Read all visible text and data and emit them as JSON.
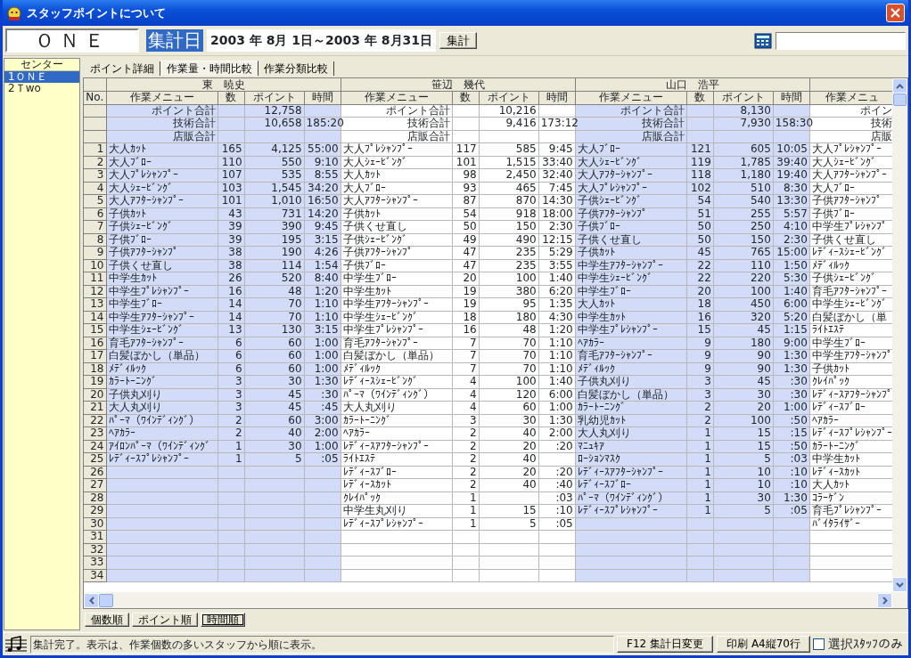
{
  "window": {
    "title": "スタッフポイントについて"
  },
  "toolbar": {
    "center_name": "ＯＮＥ",
    "date_label": "集計日",
    "date_range": "2003 年 8月 1日～2003 年 8月31日",
    "aggregate_button": "集計"
  },
  "sidebar": {
    "header": "センター",
    "items": [
      {
        "label": "1ＯＮＥ",
        "selected": true
      },
      {
        "label": "2Ｔwo",
        "selected": false
      }
    ]
  },
  "tabs": [
    {
      "label": "ポイント詳細",
      "selected": false
    },
    {
      "label": "作業量・時間比較",
      "selected": true
    },
    {
      "label": "作業分類比較",
      "selected": false
    }
  ],
  "grid": {
    "no_header": "No.",
    "row_numbers": [
      "1",
      "2",
      "3",
      "4",
      "5",
      "6",
      "7",
      "8",
      "9",
      "10",
      "11",
      "12",
      "13",
      "14",
      "15",
      "16",
      "17",
      "18",
      "19",
      "20",
      "21",
      "22",
      "23",
      "24",
      "25",
      "26",
      "27",
      "28",
      "29",
      "30",
      "31",
      "32",
      "33",
      "34"
    ],
    "staff": [
      {
        "name": "東　暁史",
        "shaded": true,
        "columns": [
          "作業メニュー",
          "数",
          "ポイント",
          "時間"
        ],
        "totals": [
          {
            "label": "ポイント合計",
            "points": "12,758"
          },
          {
            "label": "技術合計",
            "points": "10,658",
            "time": "185:20"
          },
          {
            "label": "店販合計"
          }
        ],
        "rows": [
          {
            "menu": "大人ｶｯﾄ",
            "count": "165",
            "points": "4,125",
            "time": "55:00"
          },
          {
            "menu": "大人ﾌﾞﾛｰ",
            "count": "110",
            "points": "550",
            "time": "9:10"
          },
          {
            "menu": "大人ﾌﾟﾚｼｬﾝﾌﾟｰ",
            "count": "107",
            "points": "535",
            "time": "8:55"
          },
          {
            "menu": "大人ｼｪｰﾋﾞﾝｸﾞ",
            "count": "103",
            "points": "1,545",
            "time": "34:20"
          },
          {
            "menu": "大人ｱﾌﾀｰｼｬﾝﾌﾟｰ",
            "count": "101",
            "points": "1,010",
            "time": "16:50"
          },
          {
            "menu": "子供ｶｯﾄ",
            "count": "43",
            "points": "731",
            "time": "14:20"
          },
          {
            "menu": "子供ｼｪｰﾋﾞﾝｸﾞ",
            "count": "39",
            "points": "390",
            "time": "9:45"
          },
          {
            "menu": "子供ﾌﾞﾛｰ",
            "count": "39",
            "points": "195",
            "time": "3:15"
          },
          {
            "menu": "子供ｱﾌﾀｰｼｬﾝﾌﾟ",
            "count": "38",
            "points": "190",
            "time": "4:26"
          },
          {
            "menu": "子供くせ直し",
            "count": "38",
            "points": "114",
            "time": "1:54"
          },
          {
            "menu": "中学生ｶｯﾄ",
            "count": "26",
            "points": "520",
            "time": "8:40"
          },
          {
            "menu": "中学生ﾌﾟﾚｼｬﾝﾌﾟｰ",
            "count": "16",
            "points": "48",
            "time": "1:20"
          },
          {
            "menu": "中学生ﾌﾞﾛｰ",
            "count": "14",
            "points": "70",
            "time": "1:10"
          },
          {
            "menu": "中学生ｱﾌﾀｰｼｬﾝﾌﾟｰ",
            "count": "14",
            "points": "70",
            "time": "1:10"
          },
          {
            "menu": "中学生ｼｪｰﾋﾞﾝｸﾞ",
            "count": "13",
            "points": "130",
            "time": "3:15"
          },
          {
            "menu": "育毛ｱﾌﾀｰｼｬﾝﾌﾟｰ",
            "count": "6",
            "points": "60",
            "time": "1:00"
          },
          {
            "menu": "白髪ぼかし（単品）",
            "count": "6",
            "points": "60",
            "time": "1:00"
          },
          {
            "menu": "ﾒﾃﾞｨﾙｯｸ",
            "count": "6",
            "points": "60",
            "time": "1:00"
          },
          {
            "menu": "ｶﾗｰﾄｰﾆﾝｸﾞ",
            "count": "3",
            "points": "30",
            "time": "1:30"
          },
          {
            "menu": "子供丸刈り",
            "count": "3",
            "points": "45",
            "time": ":30"
          },
          {
            "menu": "大人丸刈り",
            "count": "3",
            "points": "45",
            "time": ":45"
          },
          {
            "menu": "ﾊﾟｰﾏ（ﾜｲﾝﾃﾞｨﾝｸﾞ）",
            "count": "2",
            "points": "60",
            "time": "3:00"
          },
          {
            "menu": "ﾍｱｶﾗｰ",
            "count": "2",
            "points": "40",
            "time": "2:00"
          },
          {
            "menu": "ｱｲﾛﾝﾊﾟｰﾏ（ﾜｲﾝﾃﾞｨﾝｸﾞ",
            "count": "1",
            "points": "30",
            "time": "1:00"
          },
          {
            "menu": "ﾚﾃﾞｨｰｽﾌﾟﾚｼｬﾝﾌﾟｰ",
            "count": "1",
            "points": "5",
            "time": ":05"
          }
        ]
      },
      {
        "name": "笹辺　幾代",
        "shaded": false,
        "columns": [
          "作業メニュー",
          "数",
          "ポイント",
          "時間"
        ],
        "totals": [
          {
            "label": "ポイント合計",
            "points": "10,216"
          },
          {
            "label": "技術合計",
            "points": "9,416",
            "time": "173:12"
          },
          {
            "label": "店販合計"
          }
        ],
        "rows": [
          {
            "menu": "大人ﾌﾟﾚｼｬﾝﾌﾟｰ",
            "count": "117",
            "points": "585",
            "time": "9:45"
          },
          {
            "menu": "大人ｼｪｰﾋﾞﾝｸﾞ",
            "count": "101",
            "points": "1,515",
            "time": "33:40"
          },
          {
            "menu": "大人ｶｯﾄ",
            "count": "98",
            "points": "2,450",
            "time": "32:40"
          },
          {
            "menu": "大人ﾌﾞﾛｰ",
            "count": "93",
            "points": "465",
            "time": "7:45"
          },
          {
            "menu": "大人ｱﾌﾀｰｼｬﾝﾌﾟｰ",
            "count": "87",
            "points": "870",
            "time": "14:30"
          },
          {
            "menu": "子供ｶｯﾄ",
            "count": "54",
            "points": "918",
            "time": "18:00"
          },
          {
            "menu": "子供くせ直し",
            "count": "50",
            "points": "150",
            "time": "2:30"
          },
          {
            "menu": "子供ｼｪｰﾋﾞﾝｸﾞ",
            "count": "49",
            "points": "490",
            "time": "12:15"
          },
          {
            "menu": "子供ｱﾌﾀｰｼｬﾝﾌﾟ",
            "count": "47",
            "points": "235",
            "time": "5:29"
          },
          {
            "menu": "子供ﾌﾞﾛｰ",
            "count": "47",
            "points": "235",
            "time": "3:55"
          },
          {
            "menu": "中学生ﾌﾞﾛｰ",
            "count": "20",
            "points": "100",
            "time": "1:40"
          },
          {
            "menu": "中学生ｶｯﾄ",
            "count": "19",
            "points": "380",
            "time": "6:20"
          },
          {
            "menu": "中学生ｱﾌﾀｰｼｬﾝﾌﾟｰ",
            "count": "19",
            "points": "95",
            "time": "1:35"
          },
          {
            "menu": "中学生ｼｪｰﾋﾞﾝｸﾞ",
            "count": "18",
            "points": "180",
            "time": "4:30"
          },
          {
            "menu": "中学生ﾌﾟﾚｼｬﾝﾌﾟｰ",
            "count": "16",
            "points": "48",
            "time": "1:20"
          },
          {
            "menu": "育毛ｱﾌﾀｰｼｬﾝﾌﾟｰ",
            "count": "7",
            "points": "70",
            "time": "1:10"
          },
          {
            "menu": "白髪ぼかし（単品）",
            "count": "7",
            "points": "70",
            "time": "1:10"
          },
          {
            "menu": "ﾒﾃﾞｨﾙｯｸ",
            "count": "7",
            "points": "70",
            "time": "1:10"
          },
          {
            "menu": "ﾚﾃﾞｨｰｽｼｪｰﾋﾞﾝｸﾞ",
            "count": "4",
            "points": "100",
            "time": "1:40"
          },
          {
            "menu": "ﾊﾟｰﾏ（ﾜｲﾝﾃﾞｨﾝｸﾞ）",
            "count": "4",
            "points": "120",
            "time": "6:00"
          },
          {
            "menu": "大人丸刈り",
            "count": "4",
            "points": "60",
            "time": "1:00"
          },
          {
            "menu": "ｶﾗｰﾄｰﾆﾝｸﾞ",
            "count": "3",
            "points": "30",
            "time": "1:30"
          },
          {
            "menu": "ﾍｱｶﾗｰ",
            "count": "2",
            "points": "40",
            "time": "2:00"
          },
          {
            "menu": "ﾚﾃﾞｨｰｽｱﾌﾀｰｼｬﾝﾌﾟｰ",
            "count": "2",
            "points": "20",
            "time": ":20"
          },
          {
            "menu": "ﾗｲﾄｴｽﾃ",
            "count": "2",
            "points": "40"
          },
          {
            "menu": "ﾚﾃﾞｨｰｽﾌﾞﾛｰ",
            "count": "2",
            "points": "20",
            "time": ":20"
          },
          {
            "menu": "ﾚﾃﾞｨｰｽｶｯﾄ",
            "count": "2",
            "points": "40",
            "time": ":40"
          },
          {
            "menu": "ｸﾚｲﾊﾟｯｸ",
            "count": "1",
            "time": ":03"
          },
          {
            "menu": "中学生丸刈り",
            "count": "1",
            "points": "15",
            "time": ":10"
          },
          {
            "menu": "ﾚﾃﾞｨｰｽﾌﾟﾚｼｬﾝﾌﾟｰ",
            "count": "1",
            "points": "5",
            "time": ":05"
          }
        ]
      },
      {
        "name": "山口　浩平",
        "shaded": true,
        "columns": [
          "作業メニュー",
          "数",
          "ポイント",
          "時間"
        ],
        "totals": [
          {
            "label": "ポイント合計",
            "points": "8,130"
          },
          {
            "label": "技術合計",
            "points": "7,930",
            "time": "158:30"
          },
          {
            "label": "店販合計"
          }
        ],
        "rows": [
          {
            "menu": "大人ﾌﾞﾛｰ",
            "count": "121",
            "points": "605",
            "time": "10:05"
          },
          {
            "menu": "大人ｼｪｰﾋﾞﾝｸﾞ",
            "count": "119",
            "points": "1,785",
            "time": "39:40"
          },
          {
            "menu": "大人ｱﾌﾀｰｼｬﾝﾌﾟｰ",
            "count": "118",
            "points": "1,180",
            "time": "19:40"
          },
          {
            "menu": "大人ﾌﾟﾚｼｬﾝﾌﾟｰ",
            "count": "102",
            "points": "510",
            "time": "8:30"
          },
          {
            "menu": "子供ｼｪｰﾋﾞﾝｸﾞ",
            "count": "54",
            "points": "540",
            "time": "13:30"
          },
          {
            "menu": "子供ｱﾌﾀｰｼｬﾝﾌﾟ",
            "count": "51",
            "points": "255",
            "time": "5:57"
          },
          {
            "menu": "子供ﾌﾞﾛｰ",
            "count": "50",
            "points": "250",
            "time": "4:10"
          },
          {
            "menu": "子供くせ直し",
            "count": "50",
            "points": "150",
            "time": "2:30"
          },
          {
            "menu": "子供ｶｯﾄ",
            "count": "45",
            "points": "765",
            "time": "15:00"
          },
          {
            "menu": "中学生ｱﾌﾀｰｼｬﾝﾌﾟｰ",
            "count": "22",
            "points": "110",
            "time": "1:50"
          },
          {
            "menu": "中学生ｼｪｰﾋﾞﾝｸﾞ",
            "count": "22",
            "points": "220",
            "time": "5:30"
          },
          {
            "menu": "中学生ﾌﾞﾛｰ",
            "count": "20",
            "points": "100",
            "time": "1:40"
          },
          {
            "menu": "大人ｶｯﾄ",
            "count": "18",
            "points": "450",
            "time": "6:00"
          },
          {
            "menu": "中学生ｶｯﾄ",
            "count": "16",
            "points": "320",
            "time": "5:20"
          },
          {
            "menu": "中学生ﾌﾟﾚｼｬﾝﾌﾟｰ",
            "count": "15",
            "points": "45",
            "time": "1:15"
          },
          {
            "menu": "ﾍｱｶﾗｰ",
            "count": "9",
            "points": "180",
            "time": "9:00"
          },
          {
            "menu": "育毛ｱﾌﾀｰｼｬﾝﾌﾟｰ",
            "count": "9",
            "points": "90",
            "time": "1:30"
          },
          {
            "menu": "ﾒﾃﾞｨﾙｯｸ",
            "count": "9",
            "points": "90",
            "time": "1:30"
          },
          {
            "menu": "子供丸刈り",
            "count": "3",
            "points": "45",
            "time": ":30"
          },
          {
            "menu": "白髪ぼかし（単品）",
            "count": "3",
            "points": "30",
            "time": ":30"
          },
          {
            "menu": "ｶﾗｰﾄｰﾆﾝｸﾞ",
            "count": "2",
            "points": "20",
            "time": "1:00"
          },
          {
            "menu": "乳幼児ｶｯﾄ",
            "count": "2",
            "points": "100",
            "time": ":50"
          },
          {
            "menu": "大人丸刈り",
            "count": "1",
            "points": "15",
            "time": ":15"
          },
          {
            "menu": "ﾏﾆｭｷｱ",
            "count": "1",
            "points": "15",
            "time": ":50"
          },
          {
            "menu": "ﾛｰｼｮﾝﾏｽｸ",
            "count": "1",
            "points": "5",
            "time": ":03"
          },
          {
            "menu": "ﾚﾃﾞｨｰｽｱﾌﾀｰｼｬﾝﾌﾟｰ",
            "count": "1",
            "points": "10",
            "time": ":10"
          },
          {
            "menu": "ﾚﾃﾞｨｰｽﾌﾞﾛｰ",
            "count": "1",
            "points": "10",
            "time": ":10"
          },
          {
            "menu": "ﾊﾟｰﾏ（ﾜｲﾝﾃﾞｨﾝｸﾞ）",
            "count": "1",
            "points": "30",
            "time": "1:30"
          },
          {
            "menu": "ﾚﾃﾞｨｰｽﾌﾟﾚｼｬﾝﾌﾟｰ",
            "count": "1",
            "points": "5",
            "time": ":05"
          }
        ]
      },
      {
        "shaded": false,
        "columns": [
          "作業メニュ"
        ],
        "totals": [
          {
            "label": "ポイン"
          },
          {
            "label": "技術"
          },
          {
            "label": "店販"
          }
        ],
        "rows": [
          {
            "menu": "大人ﾌﾟﾚｼｬﾝﾌﾟｰ"
          },
          {
            "menu": "大人ｼｪｰﾋﾞﾝｸﾞ"
          },
          {
            "menu": "大人ｱﾌﾀｰｼｬﾝﾌﾟｰ"
          },
          {
            "menu": "大人ﾌﾞﾛｰ"
          },
          {
            "menu": "子供ｱﾌﾀｰｼｬﾝﾌﾟ"
          },
          {
            "menu": "子供ﾌﾞﾛｰ"
          },
          {
            "menu": "中学生ﾌﾟﾚｼｬﾝﾌﾟ"
          },
          {
            "menu": "子供くせ直し"
          },
          {
            "menu": "ﾚﾃﾞｨｰｽｼｪｰﾋﾞﾝｸﾞ"
          },
          {
            "menu": "ﾒﾃﾞｨﾙｯｸ"
          },
          {
            "menu": "子供ｼｪｰﾋﾞﾝｸﾞ"
          },
          {
            "menu": "育毛ｱﾌﾀｰｼｬﾝﾌﾟｰ"
          },
          {
            "menu": "中学生ｼｪｰﾋﾞﾝｸﾞ"
          },
          {
            "menu": "白髪ぼかし（単"
          },
          {
            "menu": "ﾗｲﾄｴｽﾃ"
          },
          {
            "menu": "中学生ﾌﾞﾛｰ"
          },
          {
            "menu": "中学生ｱﾌﾀｰｼｬﾝﾌﾟ"
          },
          {
            "menu": "子供ｶｯﾄ"
          },
          {
            "menu": "ｸﾚｲﾊﾟｯｸ"
          },
          {
            "menu": "ﾚﾃﾞｨｰｽｱﾌﾀｰｼｬﾝﾌﾟ"
          },
          {
            "menu": "ﾚﾃﾞｨｰｽﾌﾞﾛｰ"
          },
          {
            "menu": "ﾍｱｶﾗｰ"
          },
          {
            "menu": "ﾚﾃﾞｨｰｽﾌﾟﾚｼｬﾝﾌﾟｰ"
          },
          {
            "menu": "ｶﾗｰﾄｰﾆﾝｸﾞ"
          },
          {
            "menu": "中学生ｶｯﾄ"
          },
          {
            "menu": "ﾚﾃﾞｨｰｽｶｯﾄ"
          },
          {
            "menu": "大人ｶｯﾄ"
          },
          {
            "menu": "ｺﾗｰｹﾞﾝ"
          },
          {
            "menu": "育毛ﾌﾟﾚｼｬﾝﾌﾟｰ"
          },
          {
            "menu": "ﾊﾞｲﾀﾗｲｻﾞｰ"
          }
        ]
      }
    ]
  },
  "sort_buttons": [
    {
      "label": "個数順",
      "selected": false
    },
    {
      "label": "ポイント順",
      "selected": false
    },
    {
      "label": "時間順",
      "selected": true
    }
  ],
  "status_bar": {
    "message": "集計完了。表示は、作業個数の多いスタッフから順に表示。",
    "buttons": [
      "F12 集計日変更",
      "印刷 A4縦70行"
    ],
    "checkbox": {
      "label": "選択ｽﾀｯﾌのみ",
      "checked": false
    }
  }
}
